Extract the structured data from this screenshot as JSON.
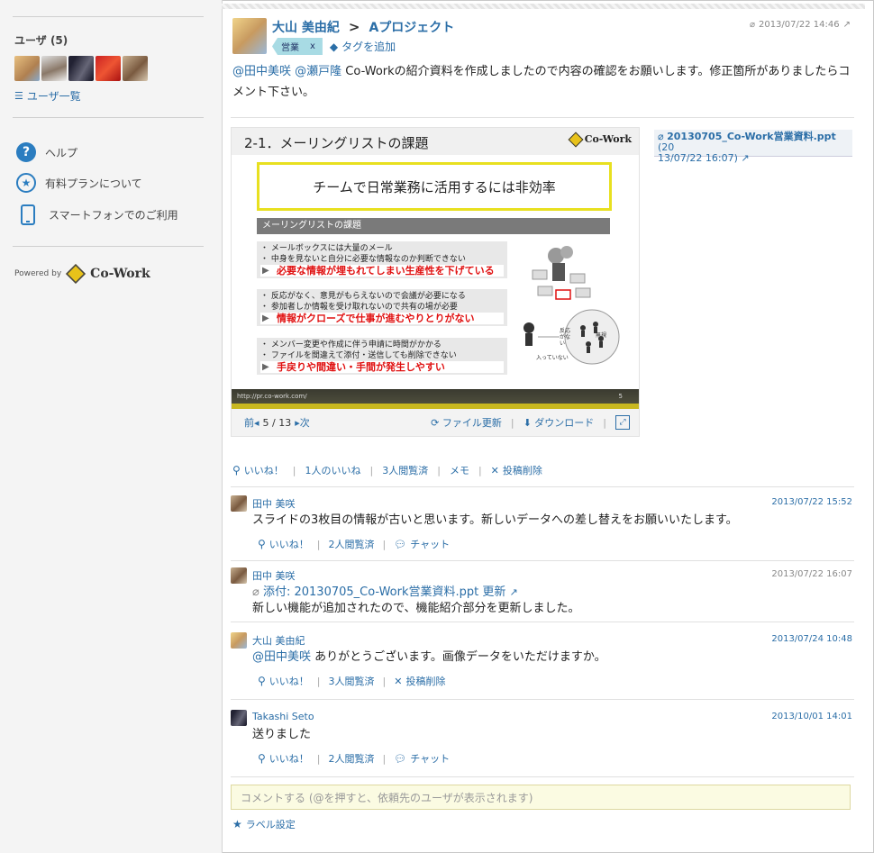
{
  "sidebar": {
    "users_title": "ユーザ (5)",
    "user_list_link": "ユーザ一覧",
    "links": [
      {
        "label": "ヘルプ",
        "icon": "help-icon"
      },
      {
        "label": "有料プランについて",
        "icon": "star-circle-icon"
      },
      {
        "label": "スマートフォンでのご利用",
        "icon": "smartphone-icon"
      }
    ],
    "powered_by": "Powered by",
    "brand": "Co-Work"
  },
  "post": {
    "author": "大山 美由紀",
    "arrow": ">",
    "project": "Aプロジェクト",
    "date": "2013/07/22 14:46",
    "tag": "営業",
    "tag_remove": "x",
    "tag_add": "タグを追加",
    "mention1": "@田中美咲",
    "mention2": "@瀬戸隆",
    "body_text": " Co-Workの紹介資料を作成しましたので内容の確認をお願いします。修正箇所がありましたらコメント下さい。"
  },
  "slide": {
    "title": "2-1．メーリングリストの課題",
    "logo_text": "Co-Work",
    "headline": "チームで日常業務に活用するには非効率",
    "section": "メーリングリストの課題",
    "block1": [
      "・ メールボックスには大量のメール",
      "・ 中身を見ないと自分に必要な情報なのか判断できない"
    ],
    "block1_red": "必要な情報が埋もれてしまい生産性を下げている",
    "block2": [
      "・ 反応がなく、意見がもらえないので会議が必要になる",
      "・ 参加者しか情報を受け取れないので共有の場が必要"
    ],
    "block2_red": "情報がクローズで仕事が進むやりとりがない",
    "block3": [
      "・ メンバー変更や作成に伴う申請に時間がかかる",
      "・ ファイルを間違えて添付・送信しても削除できない"
    ],
    "block3_red": "手戻りや間違い・手間が発生しやすい",
    "illus_label1": "反応がない",
    "illus_label2": "無視",
    "illus_label3": "入っていない",
    "footer_url": "http://pr.co-work.com/",
    "footer_page": "5",
    "nav_prev": "前",
    "nav_page": "5 / 13",
    "nav_next": "次",
    "file_update": "ファイル更新",
    "download": "ダウンロード"
  },
  "attachment": {
    "name": "20130705_Co-Work営業資料.ppt",
    "date_part1": "(20",
    "date_part2": "13/07/22 16:07"
  },
  "post_actions": {
    "like": "いいね！",
    "like_count": "1人のいいね",
    "read_count": "3人閲覧済",
    "memo": "メモ",
    "delete": "投稿削除"
  },
  "comments": [
    {
      "name": "田中 美咲",
      "date": "2013/07/22 15:52",
      "text": "スライドの3枚目の情報が古いと思います。新しいデータへの差し替えをお願いいたします。",
      "like": "いいね！",
      "read": "2人閲覧済",
      "extra": "チャット"
    },
    {
      "name": "田中 美咲",
      "date": "2013/07/22 16:07",
      "attach": "添付: 20130705_Co-Work営業資料.ppt 更新",
      "text": "新しい機能が追加されたので、機能紹介部分を更新しました。"
    },
    {
      "name": "大山 美由紀",
      "date": "2013/07/24 10:48",
      "mention": "@田中美咲",
      "text": " ありがとうございます。画像データをいただけますか。",
      "like": "いいね！",
      "read": "3人閲覧済",
      "extra": "投稿削除"
    },
    {
      "name": "Takashi Seto",
      "date": "2013/10/01 14:01",
      "text": "送りました",
      "like": "いいね！",
      "read": "2人閲覧済",
      "extra": "チャット"
    }
  ],
  "comment_input": {
    "placeholder": "コメントする (@を押すと、依頼先のユーザが表示されます)"
  },
  "label_settings": "ラベル設定",
  "colors": {
    "link": "#2b6ea7",
    "tag_bg": "#a8dbe4",
    "alert_red": "#e01010",
    "input_bg": "#fbfbe2"
  }
}
